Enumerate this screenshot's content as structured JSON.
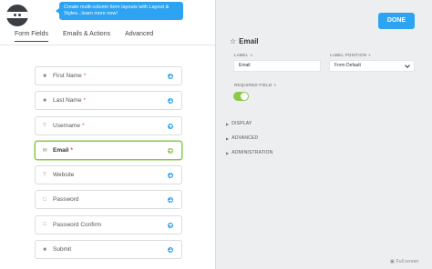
{
  "tooltip": {
    "text": "Create multi-column form layouts with Layout & Styles...learn more now!"
  },
  "tabs": [
    {
      "label": "Form Fields"
    },
    {
      "label": "Emails & Actions"
    },
    {
      "label": "Advanced"
    }
  ],
  "fields": [
    {
      "label": "First Name",
      "required": "*",
      "icon": "user-icon"
    },
    {
      "label": "Last Name",
      "required": "*",
      "icon": "user-icon"
    },
    {
      "label": "Username",
      "required": "*",
      "icon": "text-cursor-icon"
    },
    {
      "label": "Email",
      "required": "*",
      "icon": "envelope-icon"
    },
    {
      "label": "Website",
      "required": "",
      "icon": "text-cursor-icon"
    },
    {
      "label": "Password",
      "required": "",
      "icon": "square-icon"
    },
    {
      "label": "Password Confirm",
      "required": "",
      "icon": "square-icon"
    },
    {
      "label": "Submit",
      "required": "",
      "icon": "filled-square-icon"
    }
  ],
  "header": {
    "done_label": "DONE"
  },
  "settings": {
    "title": "Email",
    "label_label": "LABEL",
    "label_value": "Email",
    "position_label": "LABEL POSITION",
    "position_value": "Form Default",
    "required_label": "REQUIRED FIELD",
    "required_on": true,
    "sections": [
      {
        "label": "DISPLAY"
      },
      {
        "label": "ADVANCED"
      },
      {
        "label": "ADMINISTRATION"
      }
    ]
  },
  "footer": {
    "fullscreen_label": "Full screen"
  },
  "colors": {
    "accent": "#2ea3f2",
    "active_green": "#8cc84b",
    "panel_bg": "#eceeef"
  }
}
